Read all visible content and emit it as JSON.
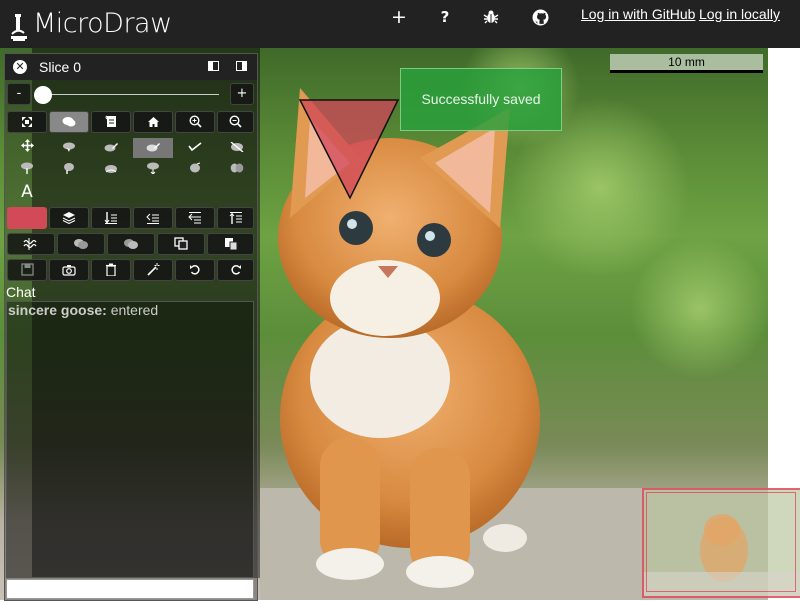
{
  "header": {
    "title": "MicroDraw",
    "icons": [
      "add-icon",
      "help-icon",
      "bug-icon",
      "github-icon"
    ],
    "help_glyph": "?",
    "add_glyph": "+",
    "login_github": "Log in with GitHub",
    "login_local": "Log in locally"
  },
  "scalebar": {
    "label": "10 mm"
  },
  "toast": {
    "message": "Successfully saved"
  },
  "panel": {
    "slice_label": "Slice 0",
    "zoom_minus": "-",
    "zoom_plus": "+",
    "slider_level": 0,
    "text_tool": "A",
    "color": "#d24a58",
    "chat_label": "Chat",
    "chat": [
      {
        "user": "sincere goose:",
        "text": "entered"
      }
    ]
  }
}
